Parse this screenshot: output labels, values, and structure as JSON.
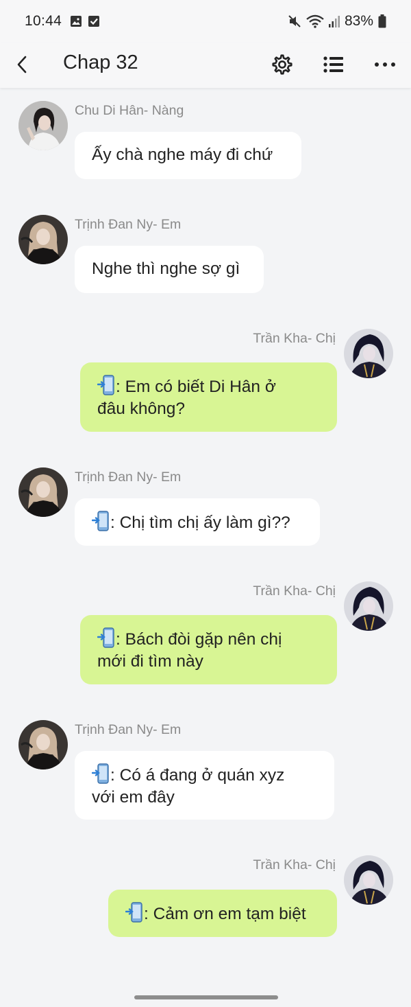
{
  "status_bar": {
    "time": "10:44",
    "battery": "83%"
  },
  "app_bar": {
    "title": "Chap 32"
  },
  "messages": [
    {
      "sender": "Chu Di Hân- Nàng",
      "text": "Ấy chà nghe máy đi chứ",
      "side": "left",
      "phone_icon": false
    },
    {
      "sender": "Trịnh Đan Ny- Em",
      "text": "Nghe thì nghe sợ gì",
      "side": "left",
      "phone_icon": false
    },
    {
      "sender": "Trần Kha- Chị",
      "text": ": Em có biết Di Hân ở",
      "text2": "đâu không?",
      "side": "right",
      "phone_icon": true
    },
    {
      "sender": "Trịnh Đan Ny- Em",
      "text": ": Chị tìm chị ấy làm gì??",
      "side": "left",
      "phone_icon": true
    },
    {
      "sender": "Trần Kha- Chị",
      "text": ": Bách đòi gặp nên chị",
      "text2": "mới đi tìm này",
      "side": "right",
      "phone_icon": true
    },
    {
      "sender": "Trịnh Đan Ny- Em",
      "text": ": Có á đang ở quán xyz",
      "text2": "với em đây",
      "side": "left",
      "phone_icon": true
    },
    {
      "sender": "Trần Kha- Chị",
      "text": ": Cảm ơn em tạm biệt",
      "side": "right",
      "phone_icon": true
    }
  ],
  "colors": {
    "background": "#f3f4f6",
    "left_bubble": "#ffffff",
    "right_bubble": "#d8f594",
    "sender_name": "#8a8a8a"
  },
  "icons": [
    "back-arrow-icon",
    "gear-icon",
    "list-icon",
    "more-icon",
    "image-icon",
    "checkbox-icon",
    "mute-icon",
    "wifi-icon",
    "signal-icon",
    "battery-icon",
    "phone-emoji-icon"
  ]
}
